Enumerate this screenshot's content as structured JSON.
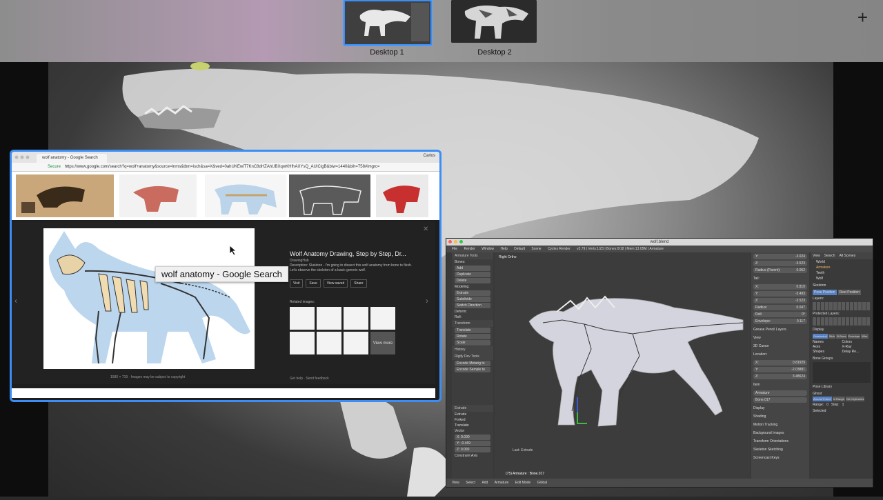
{
  "spaces": {
    "desktops": [
      {
        "label": "Desktop 1",
        "active": true
      },
      {
        "label": "Desktop 2",
        "active": false
      }
    ],
    "add_icon": "plus-icon"
  },
  "chrome": {
    "tab_title": "wolf anatomy - Google Search",
    "user": "Carlos",
    "secure_label": "Secure",
    "url": "https://www.google.com/search?q=wolf+anatomy&source=lnms&tbm=isch&sa=X&ved=0ahUKEwiT7KnC8dHZAhUBXqwKHfhAXYsQ_AUICigB&biw=1440&bih=758#imgrc=",
    "result": {
      "title": "Wolf Anatomy Drawing, Step by Step, Dr...",
      "source": "DrawingHub",
      "description": "Description: Skeleton - I'm going to dissect this wolf anatomy from bone to flesh. Let's observe the skeleton of a basic generic wolf.",
      "buttons": [
        "Visit",
        "Save",
        "View saved",
        "Share"
      ],
      "related_label": "Related images:",
      "view_more": "View more",
      "caption": "1580 × 719 · Images may be subject to copyright",
      "feedback": "Get help · Send feedback"
    },
    "tooltip": "wolf anatomy - Google Search"
  },
  "blender": {
    "title": "wolf.blend",
    "menu": [
      "File",
      "Render",
      "Window",
      "Help",
      "Default",
      "Scene",
      "Cycles Render",
      "v2.79 | Verts:1/23 | Bones:0/18 | Mem:13.05M | Armature"
    ],
    "viewport_label": "Right Ortho",
    "status": "(75) Armature : Bone.017",
    "last_op": "Last: Extrude",
    "tools": {
      "header": "Armature Tools",
      "bones_label": "Bones:",
      "bones": [
        "Add",
        "Duplicate",
        "Delete"
      ],
      "modeling_label": "Modeling:",
      "modeling": [
        "Extrude",
        "Subdivide",
        "Switch Direction"
      ],
      "deform_label": "Deform:",
      "roll_label": "Roll:",
      "transform_label": "Transform",
      "transform": [
        "Translate",
        "Rotate",
        "Scale"
      ],
      "history_label": "History",
      "rigify_label": "Rigify Dev Tools",
      "rigify": [
        "Encode Metarig to",
        "Encode Sample to"
      ],
      "extrude_header": "Extrude",
      "extrude_items": [
        "Extrude",
        "Forked"
      ],
      "translate_label": "Translate",
      "vector_label": "Vector",
      "vector": [
        "X: 0.000",
        "Y: -0.469",
        "Z: 0.000"
      ],
      "constraint_label": "Constraint Axis"
    },
    "props": {
      "rows1": [
        [
          "Y:",
          "-3.024"
        ],
        [
          "Z:",
          "-3.523"
        ],
        [
          "Radius (Parent):",
          "0.062"
        ]
      ],
      "tail_label": "Tail:",
      "rows2": [
        [
          "X:",
          "0.810"
        ],
        [
          "Y:",
          "-3.493"
        ],
        [
          "Z:",
          "-3.523"
        ],
        [
          "Radius:",
          "0.047"
        ],
        [
          "Roll:",
          "0°"
        ],
        [
          "Envelope:",
          "0.117"
        ]
      ],
      "grease_label": "Grease Pencil Layers",
      "view_label": "View",
      "cursor_label": "3D Cursor",
      "location_label": "Location:",
      "cursor": [
        [
          "X:",
          "0.81929"
        ],
        [
          "Y:",
          "-2.03881"
        ],
        [
          "Z:",
          "3.48624"
        ]
      ],
      "item_label": "Item",
      "item_values": [
        "Armature",
        "Bone.017"
      ],
      "panels": [
        "Display",
        "Shading",
        "Motion Tracking",
        "Background Images",
        "Transform Orientations",
        "Skeleton Sketching",
        "Screencast Keys"
      ]
    },
    "outliner": {
      "header": [
        "View",
        "Search",
        "All Scenes"
      ],
      "items": [
        "World",
        "Armature",
        "Teeth",
        "Wolf"
      ],
      "skeleton_label": "Skeleton",
      "pose_buttons": [
        "Pose Position",
        "Rest Position"
      ],
      "layers_label": "Layers:",
      "protected_label": "Protected Layers:",
      "display_label": "Display",
      "display_modes": [
        "Octahedral",
        "Stick",
        "B-Bone",
        "Envelope",
        "Wire"
      ],
      "checks": [
        "Names",
        "Colors",
        "Axes",
        "X-Ray",
        "Shapes",
        "Delay Re..."
      ],
      "bone_groups_label": "Bone Groups",
      "pose_library_label": "Pose Library",
      "ghost_label": "Ghost",
      "ghost_buttons": [
        "Around Frame",
        "In Range",
        "On Keyframes"
      ],
      "range_label": "Range:",
      "range_value": "0",
      "step_label": "Step:",
      "step_value": "1",
      "selected_label": "Selected"
    },
    "footer": [
      "View",
      "Select",
      "Add",
      "Armature",
      "Edit Mode",
      "Global"
    ]
  }
}
